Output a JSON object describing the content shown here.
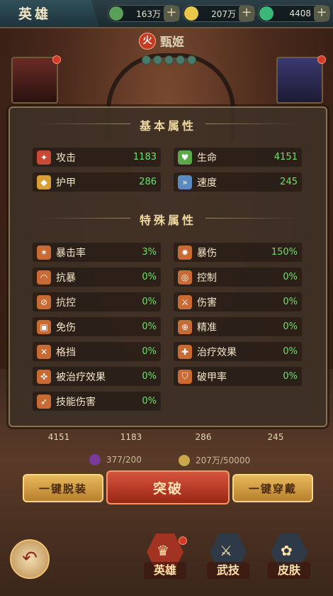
{
  "header": {
    "title": "英雄",
    "resources": [
      {
        "icon": "gem-icon",
        "value": "163万",
        "color": "#5aa05a"
      },
      {
        "icon": "coin-icon",
        "value": "207万",
        "color": "#e8c84a"
      },
      {
        "icon": "jade-icon",
        "value": "4408",
        "color": "#3ab87a"
      }
    ],
    "plus": "+"
  },
  "hero": {
    "element": "火",
    "name": "甄姬"
  },
  "panel": {
    "basic_title": "基本属性",
    "basic": [
      {
        "label": "攻击",
        "value": "1183",
        "icon": "sword-icon",
        "color": "#c94a34"
      },
      {
        "label": "生命",
        "value": "4151",
        "icon": "potion-icon",
        "color": "#5aa84a"
      },
      {
        "label": "护甲",
        "value": "286",
        "icon": "shield-icon",
        "color": "#d8a034"
      },
      {
        "label": "速度",
        "value": "245",
        "icon": "boot-icon",
        "color": "#5a8ac0"
      }
    ],
    "special_title": "特殊属性",
    "special": [
      {
        "label": "暴击率",
        "value": "3%",
        "icon": "crit-icon"
      },
      {
        "label": "暴伤",
        "value": "150%",
        "icon": "burst-icon"
      },
      {
        "label": "抗暴",
        "value": "0%",
        "icon": "arm-icon"
      },
      {
        "label": "控制",
        "value": "0%",
        "icon": "spiral-icon"
      },
      {
        "label": "抗控",
        "value": "0%",
        "icon": "ring-icon"
      },
      {
        "label": "伤害",
        "value": "0%",
        "icon": "blades-icon"
      },
      {
        "label": "免伤",
        "value": "0%",
        "icon": "bell-icon"
      },
      {
        "label": "精准",
        "value": "0%",
        "icon": "target-icon"
      },
      {
        "label": "格挡",
        "value": "0%",
        "icon": "block-icon"
      },
      {
        "label": "治疗效果",
        "value": "0%",
        "icon": "plus-icon"
      },
      {
        "label": "被治疗效果",
        "value": "0%",
        "icon": "heal-icon"
      },
      {
        "label": "破甲率",
        "value": "0%",
        "icon": "broken-shield-icon"
      },
      {
        "label": "技能伤害",
        "value": "0%",
        "icon": "skill-icon"
      }
    ]
  },
  "strip": [
    "4151",
    "1183",
    "286",
    "245"
  ],
  "costs": [
    {
      "icon": "orb-icon",
      "value": "377/200",
      "color": "#7a3a9a"
    },
    {
      "icon": "coin-icon",
      "value": "207万/50000",
      "color": "#c8a84a"
    }
  ],
  "buttons": {
    "unequip": "一键脱装",
    "breakthrough": "突破",
    "equip": "一键穿戴"
  },
  "nav": {
    "back": "↶",
    "tabs": [
      {
        "label": "英雄",
        "icon": "helmet-icon",
        "active": true
      },
      {
        "label": "武技",
        "icon": "swords-icon",
        "active": false
      },
      {
        "label": "皮肤",
        "icon": "lotus-icon",
        "active": false
      }
    ]
  }
}
